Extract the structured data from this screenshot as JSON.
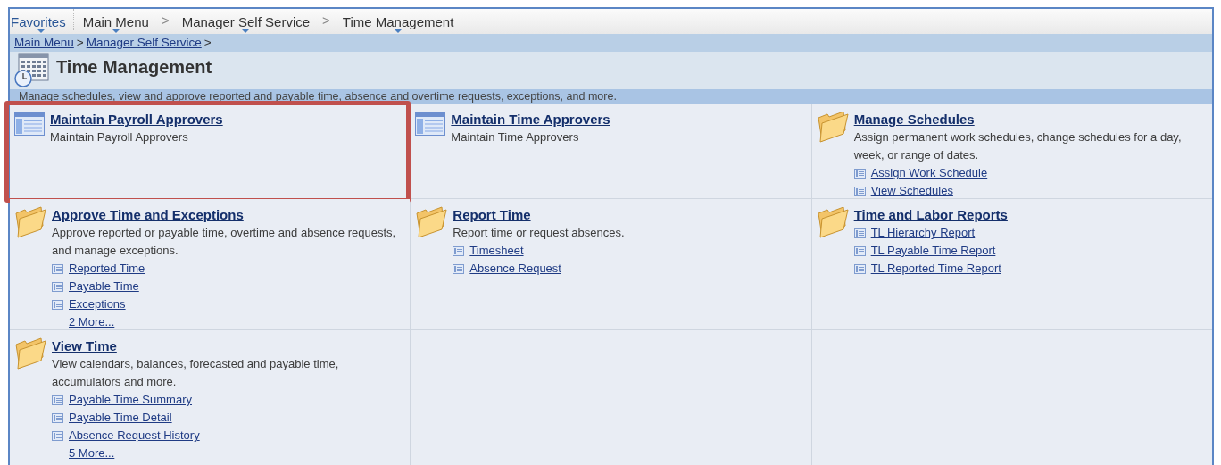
{
  "nav_bar": [
    {
      "kind": "menu",
      "label": "Favorites"
    },
    {
      "kind": "divider"
    },
    {
      "kind": "menu",
      "label": "Main Menu"
    },
    {
      "kind": "separator",
      "label": ">"
    },
    {
      "kind": "menu",
      "label": "Manager Self Service"
    },
    {
      "kind": "separator",
      "label": ">"
    },
    {
      "kind": "menu",
      "label": "Time Management"
    }
  ],
  "breadcrumbs": [
    {
      "kind": "link",
      "label": "Main Menu"
    },
    {
      "kind": "separator",
      "label": ">"
    },
    {
      "kind": "link",
      "label": "Manager Self Service"
    },
    {
      "kind": "separator",
      "label": ">"
    }
  ],
  "page": {
    "title": "Time Management",
    "description": "Manage schedules, view and approve reported and payable time, absence and overtime requests, exceptions, and more."
  },
  "tiles": [
    {
      "kind": "page",
      "title": "Maintain Payroll Approvers",
      "description": "Maintain Payroll Approvers",
      "highlighted": true
    },
    {
      "kind": "page",
      "title": "Maintain Time Approvers",
      "description": "Maintain Time Approvers",
      "highlighted": false
    },
    {
      "kind": "folder",
      "title": "Manage Schedules",
      "description": "Assign permanent work schedules, change schedules for a day, week, or range of dates.",
      "highlighted": false,
      "links": [
        "Assign Work Schedule",
        "View Schedules"
      ]
    },
    {
      "kind": "folder",
      "title": "Approve Time and Exceptions",
      "description": "Approve reported or payable time, overtime and absence requests, and manage exceptions.",
      "highlighted": false,
      "links": [
        "Reported Time",
        "Payable Time",
        "Exceptions"
      ],
      "more": "2 More..."
    },
    {
      "kind": "folder",
      "title": "Report Time",
      "description": "Report time or request absences.",
      "highlighted": false,
      "links": [
        "Timesheet",
        "Absence Request"
      ]
    },
    {
      "kind": "folder",
      "title": "Time and Labor Reports",
      "highlighted": false,
      "links": [
        "TL Hierarchy Report",
        "TL Payable Time Report",
        "TL Reported Time Report"
      ]
    },
    {
      "kind": "folder",
      "title": "View Time",
      "description": "View calendars, balances, forecasted and payable time, accumulators and more.",
      "highlighted": false,
      "links": [
        "Payable Time Summary",
        "Payable Time Detail",
        "Absence Request History"
      ],
      "more": "5 More..."
    }
  ]
}
